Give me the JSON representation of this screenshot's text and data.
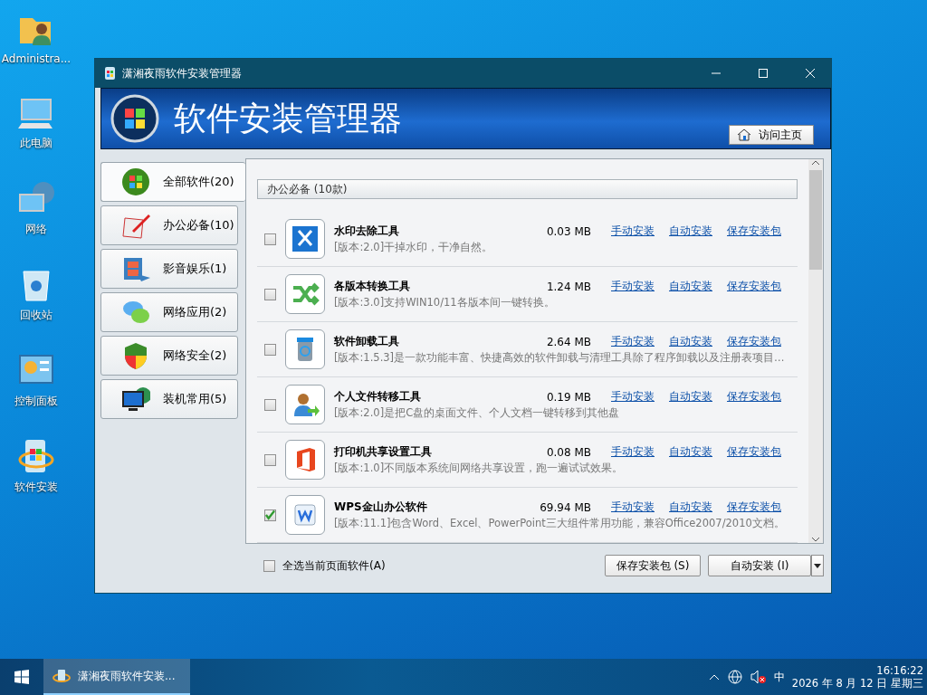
{
  "desktop_icons": [
    {
      "label": "Administra...",
      "kind": "user"
    },
    {
      "label": "此电脑",
      "kind": "pc"
    },
    {
      "label": "网络",
      "kind": "network"
    },
    {
      "label": "回收站",
      "kind": "bin"
    },
    {
      "label": "控制面板",
      "kind": "panel"
    },
    {
      "label": "软件安装",
      "kind": "setup"
    }
  ],
  "window": {
    "title": "潇湘夜雨软件安装管理器",
    "banner_title": "软件安装管理器",
    "home_button": "访问主页"
  },
  "sidebar": {
    "items": [
      {
        "label": "全部软件(20)",
        "kind": "windows",
        "selected": true
      },
      {
        "label": "办公必备(10)",
        "kind": "pen",
        "selected": false
      },
      {
        "label": "影音娱乐(1)",
        "kind": "film",
        "selected": false
      },
      {
        "label": "网络应用(2)",
        "kind": "chat",
        "selected": false
      },
      {
        "label": "网络安全(2)",
        "kind": "shield",
        "selected": false
      },
      {
        "label": "装机常用(5)",
        "kind": "monitor",
        "selected": false
      }
    ]
  },
  "group_header": "办公必备 (10款)",
  "rows": [
    {
      "name": "水印去除工具",
      "kind": "watermark",
      "size": "0.03 MB",
      "description": "[版本:2.0]干掉水印，干净自然。",
      "checked": false,
      "links": [
        "手动安装",
        "自动安装",
        "保存安装包"
      ]
    },
    {
      "name": "各版本转换工具",
      "kind": "shuffle",
      "size": "1.24 MB",
      "description": "[版本:3.0]支持WIN10/11各版本间一键转换。",
      "checked": false,
      "links": [
        "手动安装",
        "自动安装",
        "保存安装包"
      ]
    },
    {
      "name": "软件卸载工具",
      "kind": "trash",
      "size": "2.64 MB",
      "description": "[版本:1.5.3]是一款功能丰富、快捷高效的软件卸载与清理工具除了程序卸载以及注册表项目…",
      "checked": false,
      "links": [
        "手动安装",
        "自动安装",
        "保存安装包"
      ]
    },
    {
      "name": "个人文件转移工具",
      "kind": "person",
      "size": "0.19 MB",
      "description": "[版本:2.0]是把C盘的桌面文件、个人文档一键转移到其他盘",
      "checked": false,
      "links": [
        "手动安装",
        "自动安装",
        "保存安装包"
      ]
    },
    {
      "name": "打印机共享设置工具",
      "kind": "office",
      "size": "0.08 MB",
      "description": "[版本:1.0]不同版本系统间网络共享设置，跑一遍试试效果。",
      "checked": false,
      "links": [
        "手动安装",
        "自动安装",
        "保存安装包"
      ]
    },
    {
      "name": "WPS金山办公软件",
      "kind": "wps",
      "size": "69.94 MB",
      "description": "[版本:11.1]包含Word、Excel、PowerPoint三大组件常用功能，兼容Office2007/2010文档。",
      "checked": true,
      "links": [
        "手动安装",
        "自动安装",
        "保存安装包"
      ]
    }
  ],
  "footer": {
    "select_all": {
      "label": "全选当前页面软件(A)",
      "checked": false
    },
    "save_button": "保存安装包 (S)",
    "install_button": "自动安装 (I)"
  },
  "taskbar": {
    "task": "潇湘夜雨软件安装...",
    "ime": "中",
    "time": "16:16:22",
    "date": "2026 年 8 月 12 日 星期三"
  }
}
